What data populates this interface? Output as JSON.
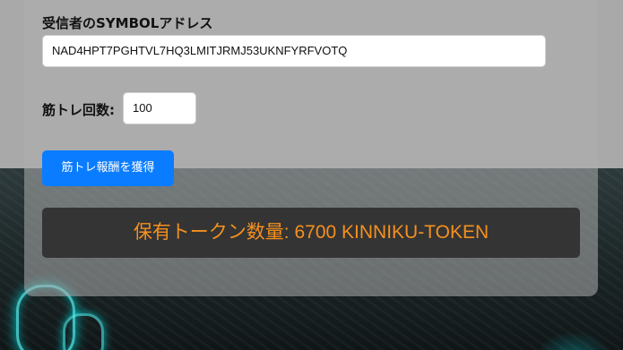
{
  "form": {
    "recipient_label": "受信者のSYMBOLアドレス",
    "recipient_value": "NAD4HPT7PGHTVL7HQ3LMITJRMJ53UKNFYRFVOTQ",
    "count_label": "筋トレ回数:",
    "count_value": "100",
    "reward_button_label": "筋トレ報酬を獲得"
  },
  "balance": {
    "text": "保有トークン数量: 6700 KINNIKU-TOKEN",
    "amount": 6700,
    "token": "KINNIKU-TOKEN"
  },
  "colors": {
    "button": "#0a7cff",
    "balance_text": "#f5901e",
    "balance_bg": "#343434"
  }
}
